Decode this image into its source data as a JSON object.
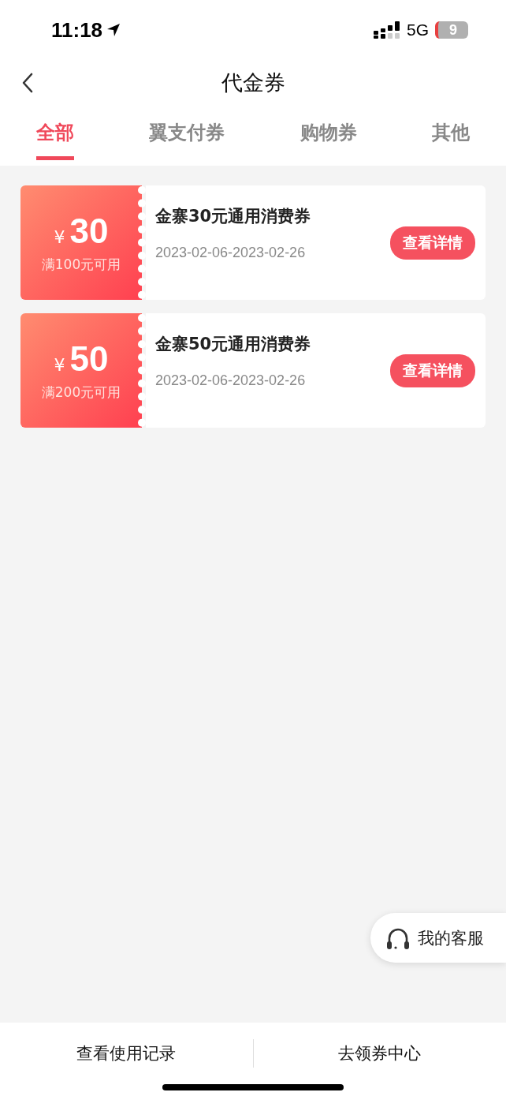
{
  "status_bar": {
    "time": "11:18",
    "network": "5G",
    "battery": "9"
  },
  "nav": {
    "title": "代金券"
  },
  "tabs": [
    {
      "label": "全部",
      "selected": true
    },
    {
      "label": "翼支付券",
      "selected": false
    },
    {
      "label": "购物券",
      "selected": false
    },
    {
      "label": "其他",
      "selected": false
    }
  ],
  "coupons": [
    {
      "currency": "¥",
      "amount": "30",
      "condition": "满100元可用",
      "title": "金寨30元通用消费券",
      "validity": "2023-02-06-2023-02-26",
      "button": "查看详情"
    },
    {
      "currency": "¥",
      "amount": "50",
      "condition": "满200元可用",
      "title": "金寨50元通用消费券",
      "validity": "2023-02-06-2023-02-26",
      "button": "查看详情"
    }
  ],
  "service_button": {
    "label": "我的客服"
  },
  "bottom_bar": [
    "查看使用记录",
    "去领券中心"
  ]
}
